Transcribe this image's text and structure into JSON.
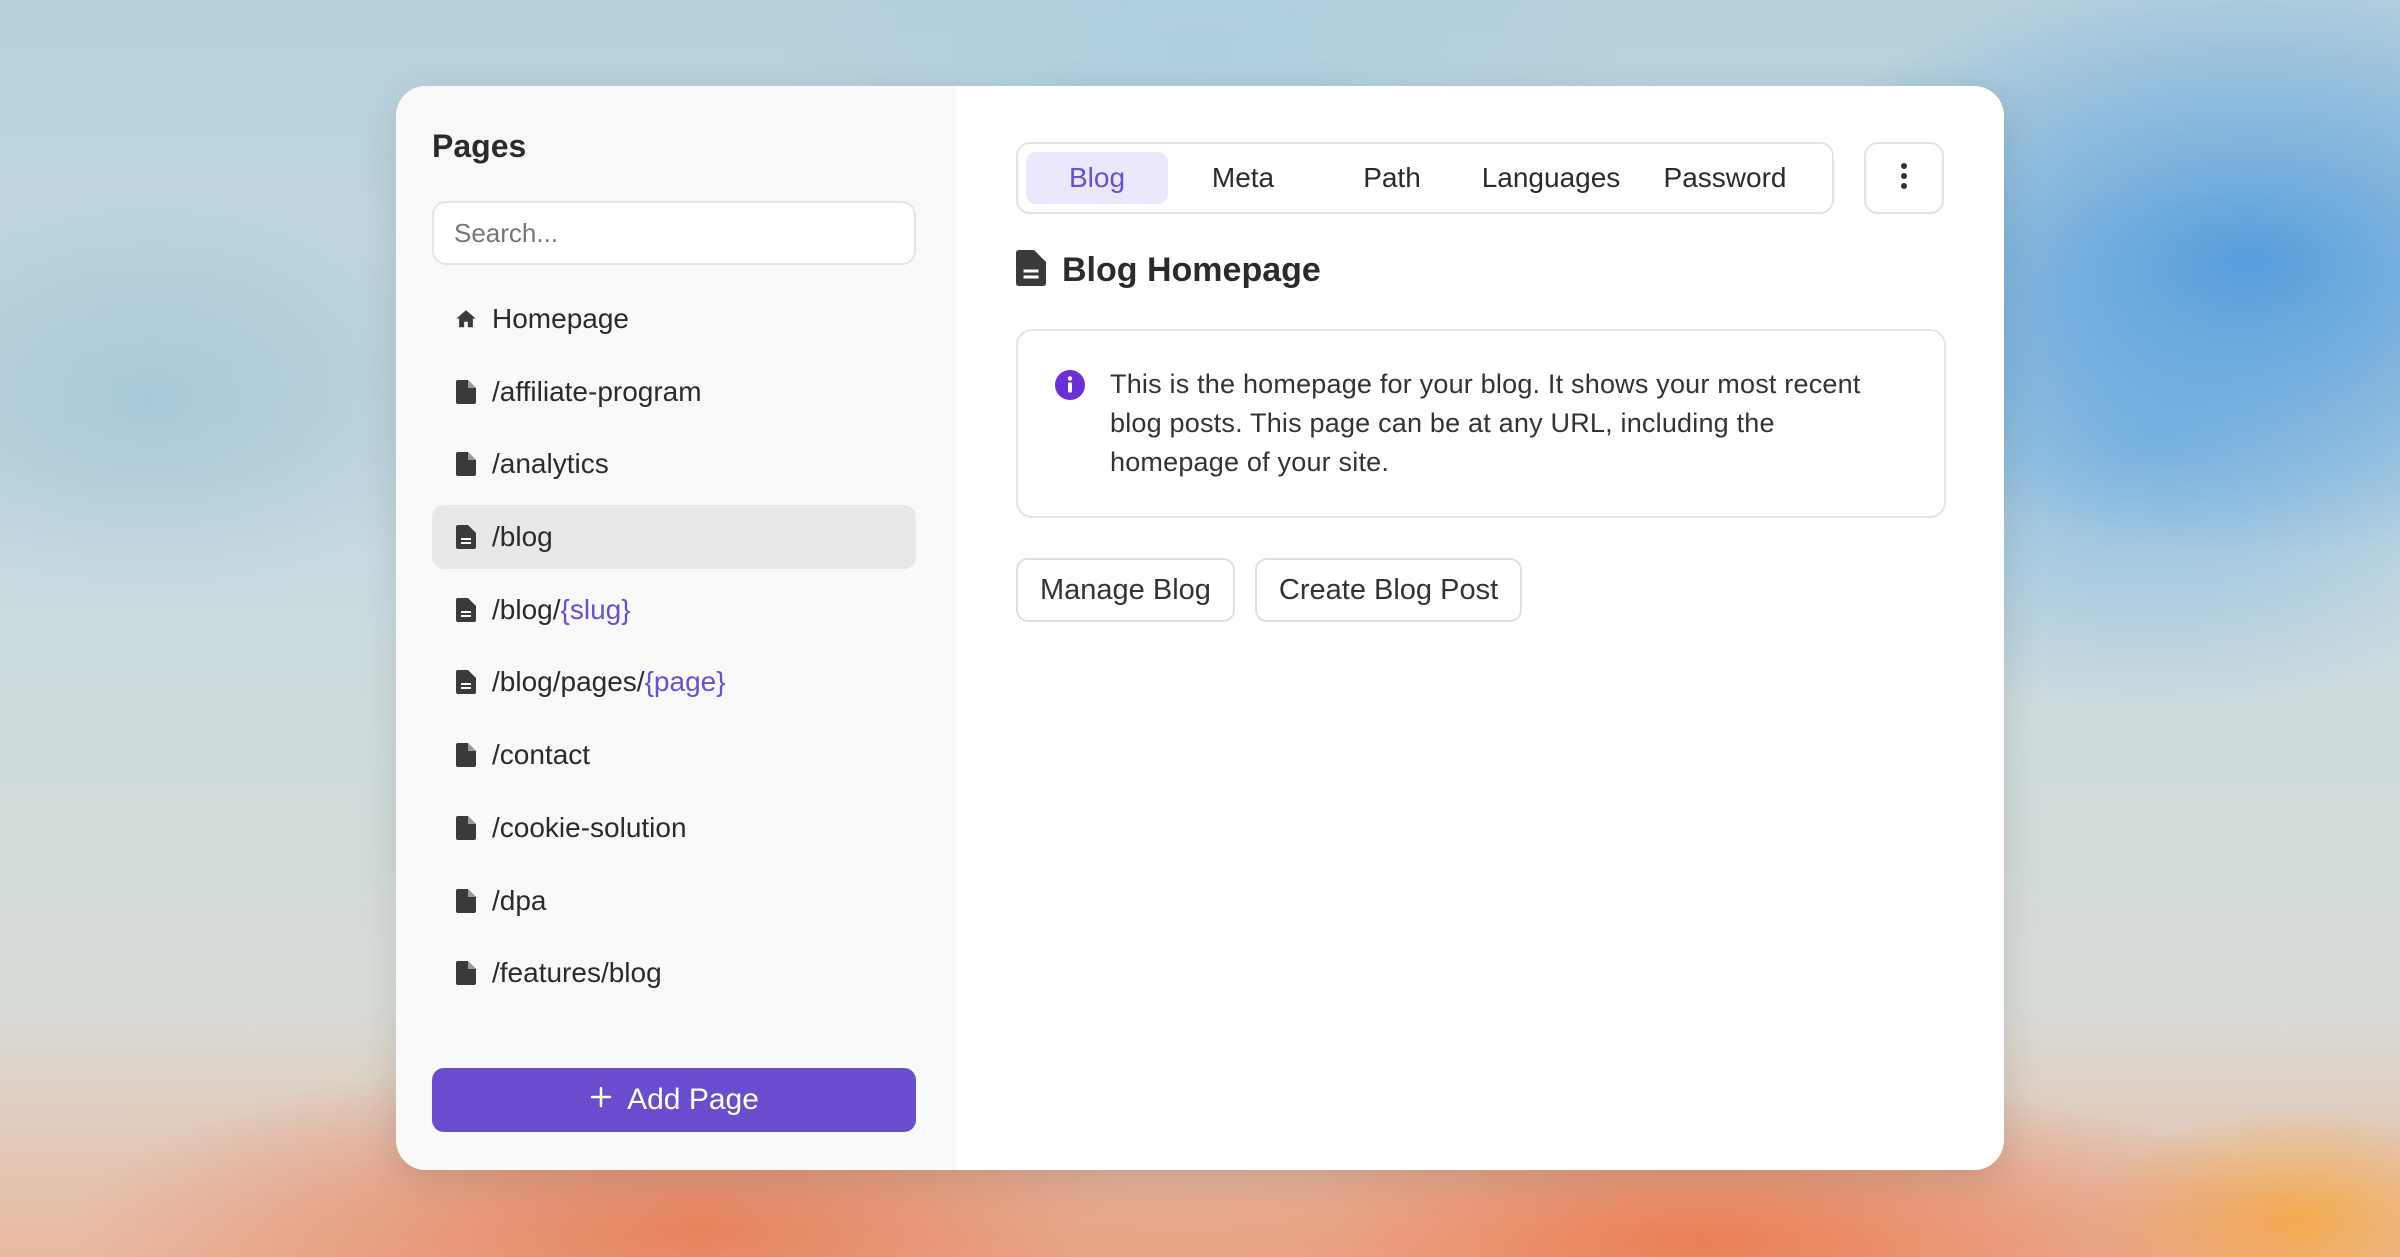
{
  "sidebar": {
    "title": "Pages",
    "search": {
      "placeholder": "Search...",
      "value": ""
    },
    "items": [
      {
        "icon": "home-icon",
        "label": "Homepage",
        "param": "",
        "active": false
      },
      {
        "icon": "file-icon",
        "label": "/affiliate-program",
        "param": "",
        "active": false
      },
      {
        "icon": "file-icon",
        "label": "/analytics",
        "param": "",
        "active": false
      },
      {
        "icon": "file-text-icon",
        "label": "/blog",
        "param": "",
        "active": true
      },
      {
        "icon": "file-text-icon",
        "label": "/blog/",
        "param": "{slug}",
        "active": false
      },
      {
        "icon": "file-text-icon",
        "label": "/blog/pages/",
        "param": "{page}",
        "active": false
      },
      {
        "icon": "file-icon",
        "label": "/contact",
        "param": "",
        "active": false
      },
      {
        "icon": "file-icon",
        "label": "/cookie-solution",
        "param": "",
        "active": false
      },
      {
        "icon": "file-icon",
        "label": "/dpa",
        "param": "",
        "active": false
      },
      {
        "icon": "file-icon",
        "label": "/features/blog",
        "param": "",
        "active": false
      }
    ],
    "add_page_label": "Add Page"
  },
  "tabs": [
    {
      "label": "Blog",
      "active": true
    },
    {
      "label": "Meta",
      "active": false
    },
    {
      "label": "Path",
      "active": false
    },
    {
      "label": "Languages",
      "active": false
    },
    {
      "label": "Password",
      "active": false
    }
  ],
  "main": {
    "heading": "Blog Homepage",
    "info_text": "This is the homepage for your blog. It shows your most recent blog posts. This page can be at any URL, including the homepage of your site.",
    "buttons": {
      "manage": "Manage Blog",
      "create": "Create Blog Post"
    }
  },
  "colors": {
    "accent": "#6a4ccf",
    "accent_light": "#ece8fb",
    "text": "#2b2b2b",
    "sidebar_bg": "#f9f9f9",
    "active_item_bg": "#e8e8e8"
  }
}
